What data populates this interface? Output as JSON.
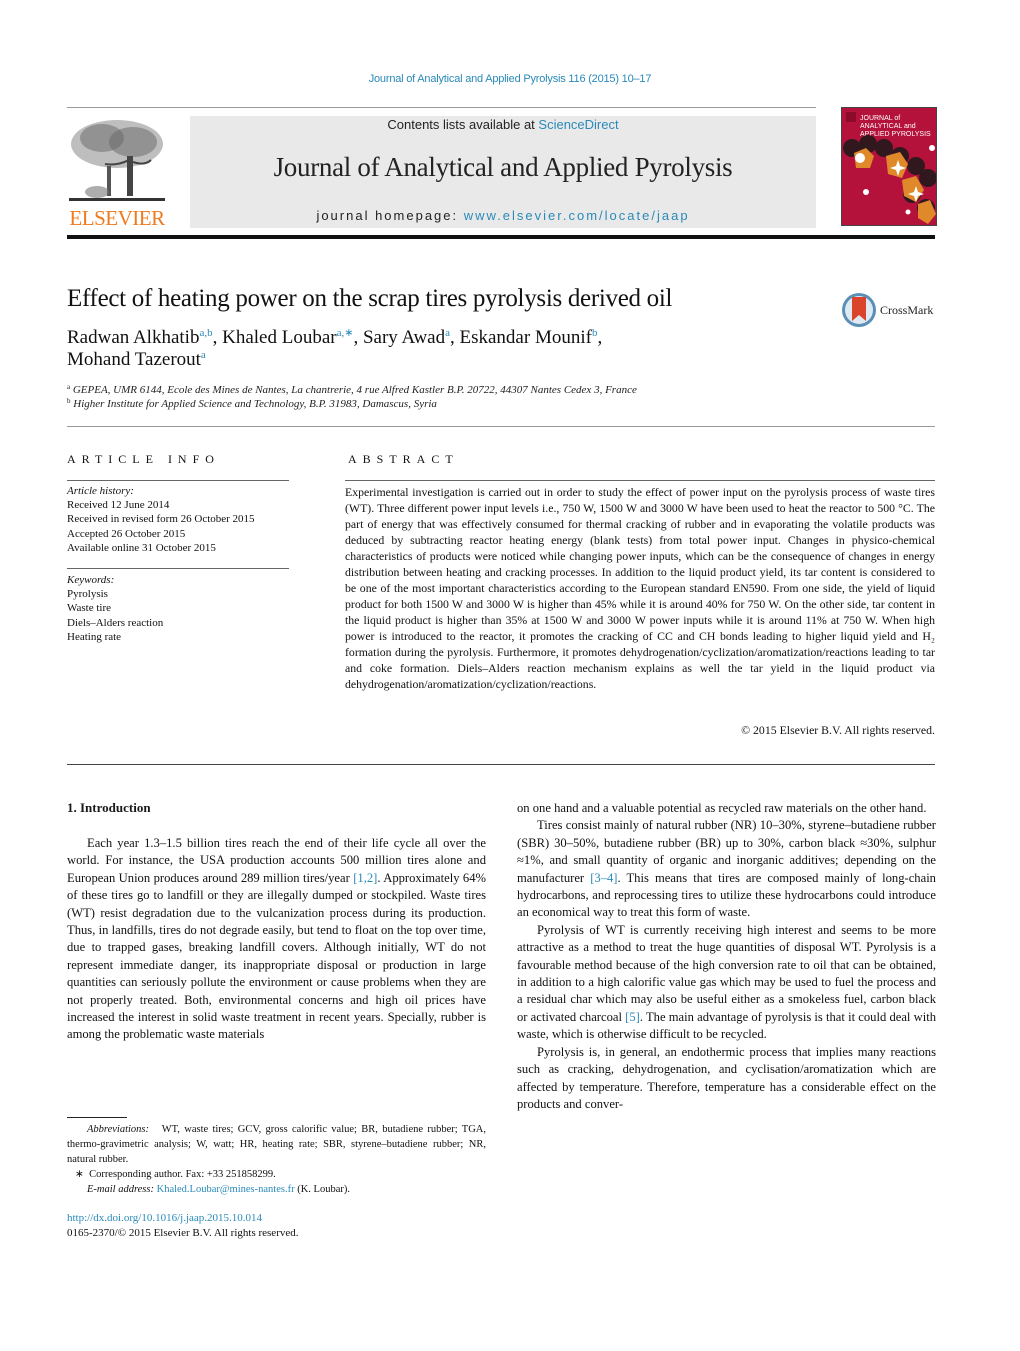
{
  "header": {
    "citation": "Journal of Analytical and Applied Pyrolysis 116 (2015) 10–17",
    "publisher_logo_text": "ELSEVIER",
    "contents_prefix": "Contents lists available at ",
    "contents_link": "ScienceDirect",
    "journal_title": "Journal of Analytical and Applied Pyrolysis",
    "homepage_prefix": "journal homepage: ",
    "homepage_link": "www.elsevier.com/locate/jaap",
    "cover_lines": [
      "JOURNAL of",
      "ANALYTICAL and",
      "APPLIED PYROLYSIS"
    ],
    "colors": {
      "link": "#2a8ab8",
      "elsevier_orange": "#f07a1e",
      "cover_red": "#b4123a",
      "cover_orange": "#e0892a"
    }
  },
  "article": {
    "title": "Effect of heating power on the scrap tires pyrolysis derived oil",
    "crossmark_label": "CrossMark",
    "authors": [
      {
        "name": "Radwan Alkhatib",
        "sup": "a,b",
        "sep": ", "
      },
      {
        "name": "Khaled Loubar",
        "sup": "a,∗",
        "sep": ", "
      },
      {
        "name": "Sary Awad",
        "sup": "a",
        "sep": ", "
      },
      {
        "name": "Eskandar Mounif",
        "sup": "b",
        "sep": ", "
      },
      {
        "name": "Mohand Tazerout",
        "sup": "a",
        "sep": ""
      }
    ],
    "affiliations": [
      {
        "key": "a",
        "text": "GEPEA, UMR 6144, Ecole des Mines de Nantes, La chantrerie, 4 rue Alfred Kastler B.P. 20722, 44307 Nantes Cedex 3, France"
      },
      {
        "key": "b",
        "text": "Higher Institute for Applied Science and Technology, B.P. 31983, Damascus, Syria"
      }
    ]
  },
  "article_info": {
    "heading": "ARTICLE INFO",
    "history_label": "Article history:",
    "history": [
      "Received 12 June 2014",
      "Received in revised form 26 October 2015",
      "Accepted 26 October 2015",
      "Available online 31 October 2015"
    ],
    "keywords_label": "Keywords:",
    "keywords": [
      "Pyrolysis",
      "Waste tire",
      "Diels–Alders reaction",
      "Heating rate"
    ]
  },
  "abstract": {
    "heading": "ABSTRACT",
    "text": "Experimental investigation is carried out in order to study the effect of power input on the pyrolysis process of waste tires (WT). Three different power input levels i.e., 750 W, 1500 W and 3000 W have been used to heat the reactor to 500 °C. The part of energy that was effectively consumed for thermal cracking of rubber and in evaporating the volatile products was deduced by subtracting reactor heating energy (blank tests) from total power input. Changes in physico-chemical characteristics of products were noticed while changing power inputs, which can be the consequence of changes in energy distribution between heating and cracking processes. In addition to the liquid product yield, its tar content is considered to be one of the most important characteristics according to the European standard EN590. From one side, the yield of liquid product for both 1500 W and 3000 W is higher than 45% while it is around 40% for 750 W. On the other side, tar content in the liquid product is higher than 35% at 1500 W and 3000 W power inputs while it is around 11% at 750 W. When high power is introduced to the reactor, it promotes the cracking of CC and CH bonds leading to higher liquid yield and H₂ formation during the pyrolysis. Furthermore, it promotes dehydrogenation/cyclization/aromatization/reactions leading to tar and coke formation. Diels–Alders reaction mechanism explains as well the tar yield in the liquid product via dehydrogenation/aromatization/cyclization/reactions.",
    "copyright": "© 2015 Elsevier B.V. All rights reserved."
  },
  "body": {
    "section_heading": "1.  Introduction",
    "left": {
      "p1_before": "Each year 1.3–1.5 billion tires reach the end of their life cycle all over the world. For instance, the USA production accounts 500 million tires alone and European Union produces around 289 million tires/year ",
      "p1_ref": "[1,2]",
      "p1_after": ". Approximately 64% of these tires go to landfill or they are illegally dumped or stockpiled. Waste tires (WT) resist degradation due to the vulcanization process during its production. Thus, in landfills, tires do not degrade easily, but tend to float on the top over time, due to trapped gases, breaking landfill covers. Although initially, WT do not represent immediate danger, its inappropriate disposal or production in large quantities can seriously pollute the environment or cause problems when they are not properly treated. Both, environmental concerns and high oil prices have increased the interest in solid waste treatment in recent years. Specially, rubber is among the problematic waste materials"
    },
    "right": {
      "p0": "on one hand and a valuable potential as recycled raw materials on the other hand.",
      "p2_before": "Tires consist mainly of natural rubber (NR) 10–30%, styrene–butadiene rubber (SBR) 30–50%, butadiene rubber (BR) up to 30%, carbon black ≈30%, sulphur ≈1%, and small quantity of organic and inorganic additives; depending on the manufacturer ",
      "p2_ref": "[3–4]",
      "p2_after": ". This means that tires are composed mainly of long-chain hydrocarbons, and reprocessing tires to utilize these hydrocarbons could introduce an economical way to treat this form of waste.",
      "p3_before": "Pyrolysis of WT is currently receiving high interest and seems to be more attractive as a method to treat the huge quantities of disposal WT. Pyrolysis is a favourable method because of the high conversion rate to oil that can be obtained, in addition to a high calorific value gas which may be used to fuel the process and a residual char which may also be useful either as a smokeless fuel, carbon black or activated charcoal ",
      "p3_ref": "[5]",
      "p3_after": ". The main advantage of pyrolysis is that it could deal with waste, which is otherwise difficult to be recycled.",
      "p4": "Pyrolysis is, in general, an endothermic process that implies many reactions such as cracking, dehydrogenation, and cyclisation/aromatization which are affected by temperature. Therefore, temperature has a considerable effect on the products and conver-"
    }
  },
  "footnotes": {
    "abbrev_label": "Abbreviations:",
    "abbrev_text": "WT, waste tires; GCV, gross calorific value; BR, butadiene rubber; TGA, thermo-gravimetric analysis; W, watt; HR, heating rate; SBR, styrene–butadiene rubber; NR, natural rubber.",
    "corresponding_mark": "∗",
    "corresponding_text": "Corresponding author. Fax: +33 251858299.",
    "email_label": "E-mail address:",
    "email": "Khaled.Loubar@mines-nantes.fr",
    "email_suffix": " (K. Loubar).",
    "doi": "http://dx.doi.org/10.1016/j.jaap.2015.10.014",
    "issn_line": "0165-2370/© 2015 Elsevier B.V. All rights reserved."
  }
}
